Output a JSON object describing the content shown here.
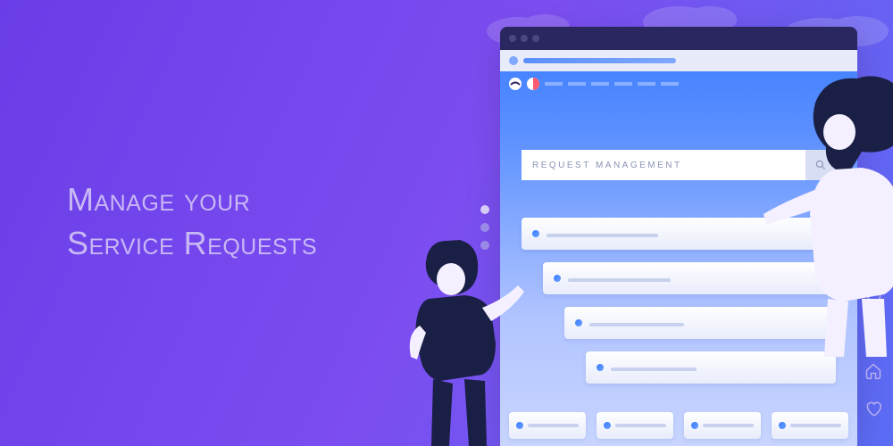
{
  "headline": {
    "line1": "Manage your",
    "line2": "Service Requests"
  },
  "search": {
    "placeholder": "REQUEST MANAGEMENT"
  }
}
